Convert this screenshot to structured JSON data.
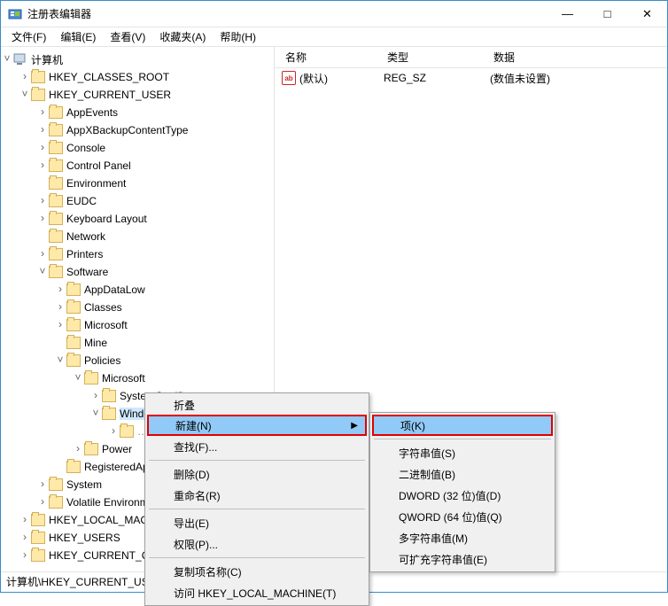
{
  "window": {
    "title": "注册表编辑器"
  },
  "winbtns": {
    "min": "—",
    "max": "□",
    "close": "✕"
  },
  "menu": {
    "file": "文件(F)",
    "edit": "编辑(E)",
    "view": "查看(V)",
    "fav": "收藏夹(A)",
    "help": "帮助(H)"
  },
  "tree": {
    "root": "计算机",
    "hkcr": "HKEY_CLASSES_ROOT",
    "hkcu": "HKEY_CURRENT_USER",
    "appevents": "AppEvents",
    "appx": "AppXBackupContentType",
    "console": "Console",
    "cpanel": "Control Panel",
    "env": "Environment",
    "eudc": "EUDC",
    "keyboard": "Keyboard Layout",
    "network": "Network",
    "printers": "Printers",
    "software": "Software",
    "appdatalow": "AppDataLow",
    "classes": "Classes",
    "microsoft": "Microsoft",
    "mine": "Mine",
    "policies": "Policies",
    "ms2": "Microsoft",
    "syscert": "SystemCertificates",
    "windows": "Windows",
    "power": "Power",
    "registered": "RegisteredApplications",
    "system": "System",
    "volenv": "Volatile Environment",
    "hklm": "HKEY_LOCAL_MACHINE",
    "hku": "HKEY_USERS",
    "hkcc": "HKEY_CURRENT_CONFIG"
  },
  "list": {
    "hdr_name": "名称",
    "hdr_type": "类型",
    "hdr_data": "数据",
    "row_name": "(默认)",
    "row_type": "REG_SZ",
    "row_data": "(数值未设置)"
  },
  "ctx1": {
    "collapse": "折叠",
    "new": "新建(N)",
    "find": "查找(F)...",
    "delete": "删除(D)",
    "rename": "重命名(R)",
    "export": "导出(E)",
    "perm": "权限(P)...",
    "copykey": "复制项名称(C)",
    "goto": "访问 HKEY_LOCAL_MACHINE(T)"
  },
  "ctx2": {
    "key": "项(K)",
    "string": "字符串值(S)",
    "binary": "二进制值(B)",
    "dword": "DWORD (32 位)值(D)",
    "qword": "QWORD (64 位)值(Q)",
    "multi": "多字符串值(M)",
    "expand": "可扩充字符串值(E)"
  },
  "status": {
    "path": "计算机\\HKEY_CURRENT_USER\\Software\\Policies\\Microsoft\\Windows"
  }
}
